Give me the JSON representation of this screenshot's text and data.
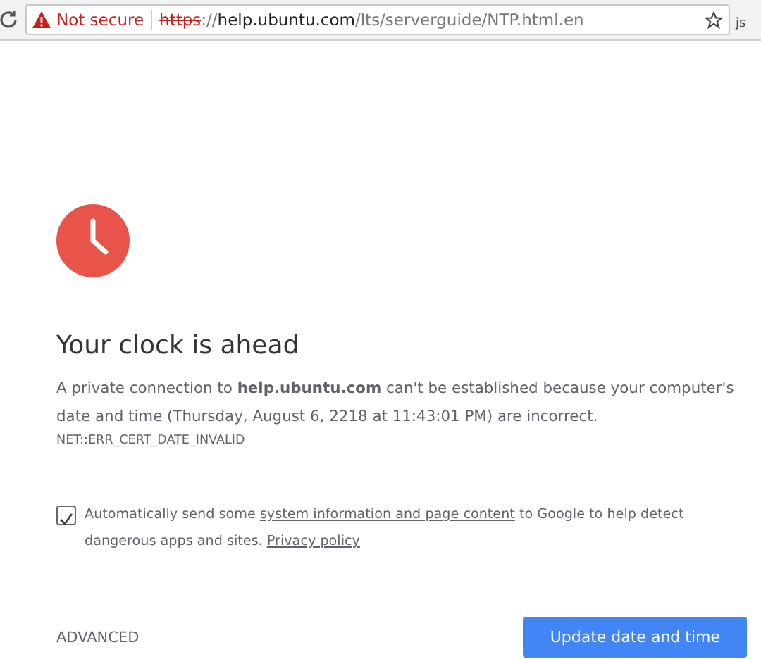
{
  "address_bar": {
    "security_label": "Not secure",
    "scheme": "https",
    "separator": "://",
    "host": "help.ubuntu.com",
    "path": "/lts/serverguide/NTP.html.en"
  },
  "extension": {
    "label": "js"
  },
  "error": {
    "title": "Your clock is ahead",
    "message": "A private connection to **help.ubuntu.com** can't be established because your computer's date and time (Thursday, August 6, 2218 at 11:43:01 PM) are incorrect.",
    "code": "NET::ERR_CERT_DATE_INVALID"
  },
  "report": {
    "checked": true,
    "text_before": "Automatically send some ",
    "link": "system information and page content",
    "text_middle": " to Google to help detect dangerous apps and sites. ",
    "policy_link": "Privacy policy"
  },
  "buttons": {
    "advanced": "ADVANCED",
    "primary": "Update date and time"
  }
}
